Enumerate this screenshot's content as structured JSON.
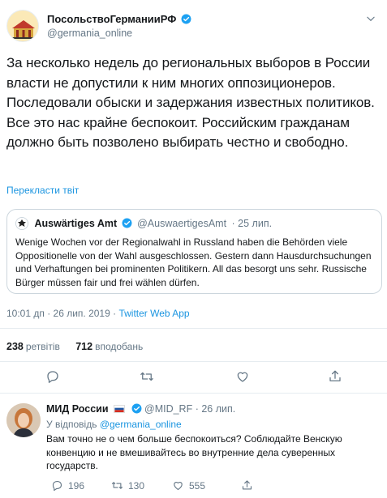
{
  "tweet": {
    "author": {
      "name": "ПосольствоГерманииРФ",
      "handle": "@germania_online",
      "avatar_icon": "embassy-building-icon"
    },
    "text": "За несколько недель до региональных выборов в России власти не допустили к ним многих оппозиционеров. Последовали обыски и задержания известных политиков. Все это нас крайне беспокоит. Российским гражданам должно быть позволено выбирать честно и свободно.",
    "translate_label": "Перекласти твіт",
    "quote": {
      "name": "Auswärtiges Amt",
      "handle": "@AuswaertigesAmt",
      "time": "· 25 лип.",
      "text": "Wenige Wochen vor der Regionalwahl in Russland haben die Behörden viele Oppositionelle von der Wahl ausgeschlossen. Gestern dann Hausdurchsuchungen und Verhaftungen bei prominenten Politikern. All das besorgt uns sehr. Russische Bürger müssen fair und frei wählen dürfen."
    },
    "timestamp": "10:01 дп · 26 лип. 2019 · ",
    "app": "Twitter Web App",
    "retweets_count": "238",
    "retweets_label": "ретвітів",
    "likes_count": "712",
    "likes_label": "вподобань"
  },
  "reply": {
    "name": "МИД России",
    "handle": "@MID_RF",
    "time": "· 26 лип.",
    "reply_to_prefix": "У відповідь",
    "reply_to_handle": "@germania_online",
    "text": "Вам точно не о чем больше беспокоиться? Соблюдайте Венскую конвенцию и не вмешивайтесь во внутренние дела суверенных государств.",
    "reply_count": "196",
    "retweet_count": "130",
    "like_count": "555"
  },
  "colors": {
    "link": "#1b95e0",
    "muted": "#657786",
    "border": "#e6ecf0",
    "verified": "#1da1f2"
  }
}
